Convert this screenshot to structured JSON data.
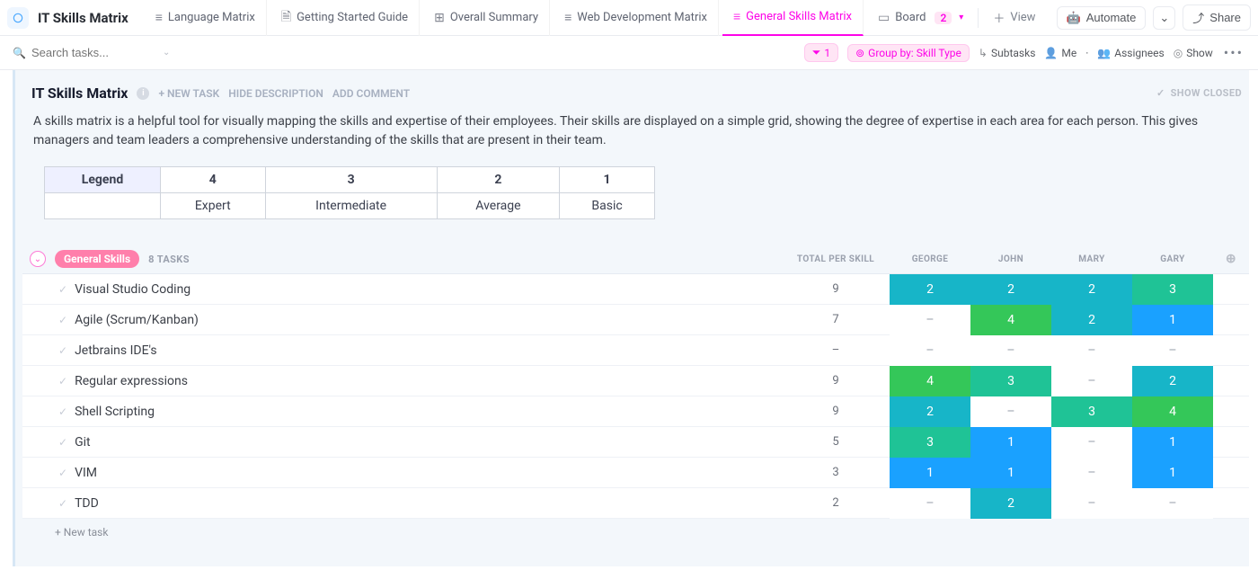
{
  "header": {
    "title": "IT Skills Matrix",
    "tabs": [
      {
        "label": "Language Matrix"
      },
      {
        "label": "Getting Started Guide"
      },
      {
        "label": "Overall Summary"
      },
      {
        "label": "Web Development Matrix"
      },
      {
        "label": "General Skills Matrix",
        "active": true
      },
      {
        "label": "Board",
        "badge": "2"
      }
    ],
    "add_view": "View",
    "automate": "Automate",
    "share": "Share"
  },
  "toolbar": {
    "search_placeholder": "Search tasks...",
    "filter_count": "1",
    "group_by_label": "Group by: Skill Type",
    "subtasks": "Subtasks",
    "me": "Me",
    "assignees": "Assignees",
    "show": "Show"
  },
  "panel": {
    "title": "IT Skills Matrix",
    "new_task": "+ NEW TASK",
    "hide_desc": "HIDE DESCRIPTION",
    "add_comment": "ADD COMMENT",
    "show_closed": "SHOW CLOSED",
    "description": "A skills matrix is a helpful tool for visually mapping the skills and expertise of their employees. Their skills are displayed on a simple grid, showing the degree of expertise in each area for each person. This gives managers and team leaders a comprehensive understanding of the skills that are present in their team."
  },
  "legend": {
    "header": "Legend",
    "levels": [
      "4",
      "3",
      "2",
      "1"
    ],
    "labels": [
      "Expert",
      "Intermediate",
      "Average",
      "Basic"
    ]
  },
  "group": {
    "name": "General Skills",
    "count": "8 TASKS",
    "total_col": "TOTAL PER SKILL",
    "people": [
      "GEORGE",
      "JOHN",
      "MARY",
      "GARY"
    ]
  },
  "rows": [
    {
      "name": "Visual Studio Coding",
      "total": "9",
      "vals": [
        "2",
        "2",
        "2",
        "3"
      ]
    },
    {
      "name": "Agile (Scrum/Kanban)",
      "total": "7",
      "vals": [
        "–",
        "4",
        "2",
        "1"
      ]
    },
    {
      "name": "Jetbrains IDE's",
      "total": "–",
      "vals": [
        "–",
        "–",
        "–",
        "–"
      ]
    },
    {
      "name": "Regular expressions",
      "total": "9",
      "vals": [
        "4",
        "3",
        "–",
        "2"
      ]
    },
    {
      "name": "Shell Scripting",
      "total": "9",
      "vals": [
        "2",
        "–",
        "3",
        "4"
      ]
    },
    {
      "name": "Git",
      "total": "5",
      "vals": [
        "3",
        "1",
        "–",
        "1"
      ]
    },
    {
      "name": "VIM",
      "total": "3",
      "vals": [
        "1",
        "1",
        "–",
        "1"
      ]
    },
    {
      "name": "TDD",
      "total": "2",
      "vals": [
        "–",
        "2",
        "–",
        "–"
      ]
    }
  ],
  "new_task_row": "+ New task"
}
